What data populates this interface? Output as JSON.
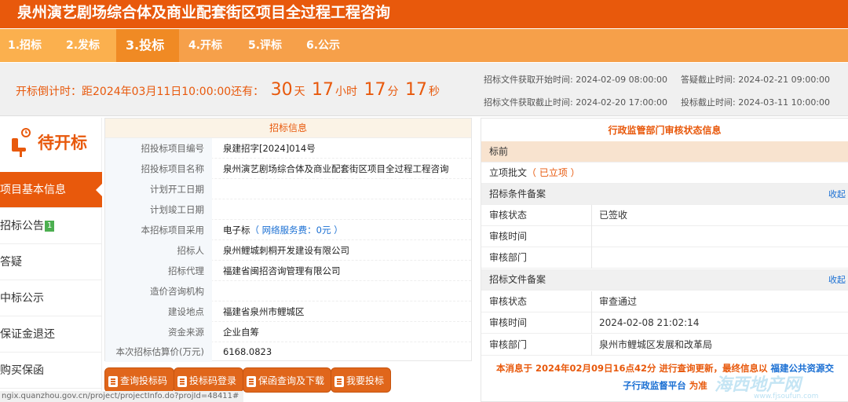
{
  "title": "泉州演艺剧场综合体及商业配套街区项目全过程工程咨询",
  "steps": [
    "1.招标",
    "2.发标",
    "3.投标",
    "4.开标",
    "5.评标",
    "6.公示"
  ],
  "countdown": {
    "prefix": "开标倒计时：距2024年03月11日10:00:00还有：",
    "days": "30",
    "days_unit": "天",
    "hours": "17",
    "hours_unit": "小时",
    "minutes": "17",
    "minutes_unit": "分",
    "seconds": "17",
    "seconds_unit": "秒"
  },
  "times": {
    "doc_start_label": "招标文件获取开始时间:",
    "doc_start": "2024-02-09 08:00:00",
    "qa_end_label": "答疑截止时间:",
    "qa_end": "2024-02-21 09:00:00",
    "doc_end_label": "招标文件获取截止时间:",
    "doc_end": "2024-02-20 17:00:00",
    "bid_end_label": "投标截止时间:",
    "bid_end": "2024-03-11 10:00:00"
  },
  "status": "待开标",
  "menu": [
    {
      "label": "项目基本信息"
    },
    {
      "label": "招标公告",
      "badge": "1"
    },
    {
      "label": "答疑"
    },
    {
      "label": "中标公示"
    },
    {
      "label": "保证金退还"
    },
    {
      "label": "购买保函"
    }
  ],
  "info": {
    "header": "招标信息",
    "rows": [
      {
        "k": "招投标项目编号",
        "v": "泉建招字[2024]014号"
      },
      {
        "k": "招投标项目名称",
        "v": "泉州演艺剧场综合体及商业配套街区项目全过程工程咨询"
      },
      {
        "k": "计划开工日期",
        "v": ""
      },
      {
        "k": "计划竣工日期",
        "v": ""
      },
      {
        "k": "本招标项目采用",
        "v": "电子标",
        "v_extra": "（ 网络服务费：0元 ）"
      },
      {
        "k": "招标人",
        "v": "泉州鲤城刺桐开发建设有限公司"
      },
      {
        "k": "招标代理",
        "v": "福建省闽招咨询管理有限公司"
      },
      {
        "k": "造价咨询机构",
        "v": ""
      },
      {
        "k": "建设地点",
        "v": "福建省泉州市鲤城区"
      },
      {
        "k": "资金来源",
        "v": "企业自筹"
      },
      {
        "k": "本次招标估算价(万元)",
        "v": "6168.0823"
      }
    ]
  },
  "buttons": [
    "查询投标码",
    "投标码登录",
    "保函查询及下载",
    "我要投标"
  ],
  "review": {
    "header": "行政监管部门审核状态信息",
    "stage": "标前",
    "approval_label": "立项批文",
    "approval_status": "（ 已立项 ）",
    "sec1": "招标条件备案",
    "collapse": "收起",
    "sec1_rows": [
      {
        "k": "审核状态",
        "v": "已签收"
      },
      {
        "k": "审核时间",
        "v": ""
      },
      {
        "k": "审核部门",
        "v": ""
      }
    ],
    "sec2": "招标文件备案",
    "sec2_rows": [
      {
        "k": "审核状态",
        "v": "审查通过"
      },
      {
        "k": "审核时间",
        "v": "2024-02-08 21:02:14"
      },
      {
        "k": "审核部门",
        "v": "泉州市鲤城区发展和改革局"
      }
    ]
  },
  "notice": {
    "line1": "本消息于 2024年02月09日16点42分 进行查询更新，最终信息以",
    "link1": "福建公共资源交",
    "line2_link": "子行政监督平台",
    "line2_tail": "为准"
  },
  "url": "ngix.quanzhou.gov.cn/project/projectInfo.do?projId=48411#",
  "watermark": "海西地产网",
  "watermark_sub": "www.fjsoufun.com"
}
